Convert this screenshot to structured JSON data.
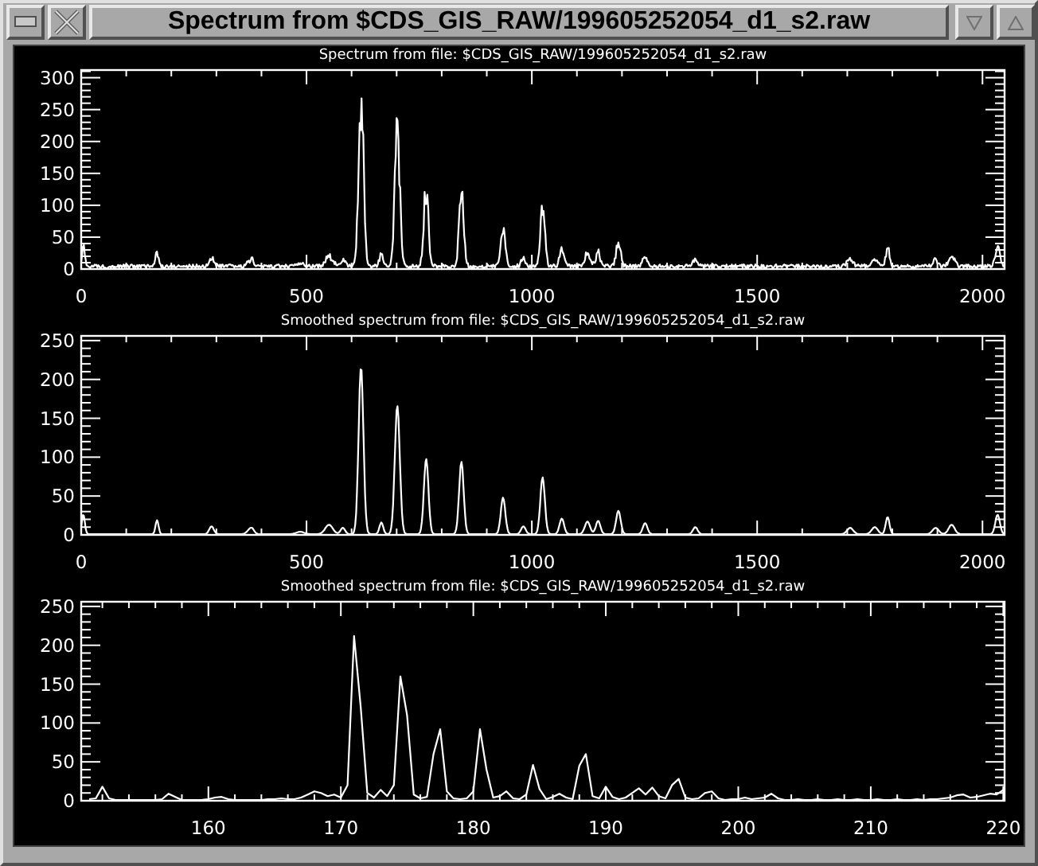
{
  "window": {
    "title": "Spectrum from $CDS_GIS_RAW/199605252054_d1_s2.raw"
  },
  "plots": [
    {
      "kind": "raw",
      "title": "Spectrum from file: $CDS_GIS_RAW/199605252054_d1_s2.raw",
      "y_tick_labels": [
        "300",
        "250",
        "200",
        "150",
        "100",
        "50",
        "0"
      ],
      "x_tick_labels": [
        "0",
        "500",
        "1000",
        "1500",
        "2000"
      ]
    },
    {
      "kind": "smoothed",
      "title": "Smoothed spectrum from file: $CDS_GIS_RAW/199605252054_d1_s2.raw",
      "y_tick_labels": [
        "250",
        "200",
        "150",
        "100",
        "50",
        "0"
      ],
      "x_tick_labels": [
        "0",
        "500",
        "1000",
        "1500",
        "2000"
      ]
    },
    {
      "title": "Smoothed spectrum from file: $CDS_GIS_RAW/199605252054_d1_s2.raw",
      "chart_data": {
        "type": "line",
        "xlim": [
          150.4,
          220.1
        ],
        "ylim": [
          0,
          256
        ],
        "xticks": [
          160,
          170,
          180,
          190,
          200,
          210,
          220
        ],
        "yticks": [
          0,
          50,
          100,
          150,
          200,
          250
        ],
        "x": [
          151,
          151.5,
          152,
          152.5,
          153,
          153.5,
          154,
          154.5,
          155,
          155.5,
          156,
          156.5,
          157,
          157.5,
          158,
          158.5,
          159,
          159.5,
          160,
          160.5,
          161,
          161.5,
          162,
          162.5,
          163,
          163.5,
          164,
          164.5,
          165,
          165.5,
          166,
          166.5,
          167,
          167.5,
          168,
          168.5,
          169,
          169.5,
          170,
          170.5,
          171,
          171.5,
          172,
          172.5,
          173,
          173.5,
          174,
          174.5,
          175,
          175.5,
          176,
          176.5,
          177,
          177.5,
          178,
          178.5,
          179,
          179.5,
          180,
          180.5,
          181,
          181.5,
          182,
          182.5,
          183,
          183.5,
          184,
          184.5,
          185,
          185.5,
          186,
          186.5,
          187,
          187.5,
          188,
          188.5,
          189,
          189.5,
          190,
          190.5,
          191,
          191.5,
          192,
          192.5,
          193,
          193.5,
          194,
          194.5,
          195,
          195.5,
          196,
          196.5,
          197,
          197.5,
          198,
          198.5,
          199,
          199.5,
          200,
          200.5,
          201,
          201.5,
          202,
          202.5,
          203,
          203.5,
          204,
          204.5,
          205,
          205.5,
          206,
          206.5,
          207,
          207.5,
          208,
          208.5,
          209,
          209.5,
          210,
          210.5,
          211,
          211.5,
          212,
          212.5,
          213,
          213.5,
          214,
          214.5,
          215,
          215.5,
          216,
          216.5,
          217,
          217.5,
          218,
          218.5,
          219,
          219.5,
          220
        ],
        "series": [
          {
            "color": "#ffffff",
            "values": [
              2,
              3,
              18,
              3,
              1,
              1,
              1,
              1,
              1,
              1,
              1,
              2,
              9,
              5,
              1,
              1,
              1,
              1,
              2,
              4,
              5,
              2,
              1,
              1,
              1,
              1,
              1,
              2,
              2,
              3,
              2,
              2,
              4,
              8,
              12,
              10,
              6,
              8,
              4,
              20,
              212,
              120,
              10,
              4,
              14,
              6,
              20,
              160,
              110,
              8,
              3,
              5,
              60,
              92,
              12,
              3,
              2,
              3,
              12,
              92,
              40,
              4,
              6,
              12,
              3,
              2,
              8,
              46,
              15,
              2,
              5,
              9,
              4,
              2,
              45,
              60,
              6,
              3,
              18,
              5,
              2,
              4,
              10,
              16,
              8,
              17,
              6,
              3,
              20,
              28,
              4,
              2,
              3,
              10,
              12,
              3,
              1,
              2,
              2,
              4,
              2,
              3,
              4,
              9,
              3,
              1,
              1,
              2,
              1,
              1,
              2,
              1,
              1,
              2,
              1,
              1,
              2,
              1,
              1,
              2,
              1,
              1,
              2,
              1,
              1,
              2,
              1,
              2,
              2,
              3,
              4,
              7,
              8,
              4,
              5,
              7,
              9,
              8,
              14
            ]
          }
        ]
      }
    }
  ]
}
